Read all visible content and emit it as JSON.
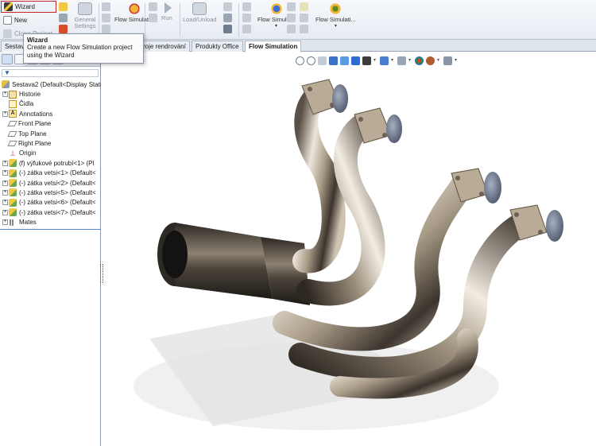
{
  "ribbon": {
    "wizard_label": "Wizard",
    "new_label": "New",
    "clone_label": "Clone Project",
    "general_settings_label": "General Settings",
    "flow_simulation_1_label": "Flow Simulati...",
    "run_label": "Run",
    "load_unload_label": "Load/Unload",
    "flow_simulation_2_label": "Flow Simula...",
    "flow_simulation_3_label": "Flow Simulati..."
  },
  "tooltip": {
    "title": "Wizard",
    "text": "Create a new Flow Simulation project using the Wizard"
  },
  "tabs": [
    {
      "label": "Sestav"
    },
    {
      "label": "roje rendrování"
    },
    {
      "label": "Produkty Office"
    },
    {
      "label": "Flow Simulation",
      "active": true
    }
  ],
  "tree": {
    "filter_label": "▼",
    "items": [
      {
        "label": "Sestava2  (Default<Display State",
        "icon": "assembly-icon"
      },
      {
        "label": "Historie",
        "icon": "history-folder-icon"
      },
      {
        "label": "Čidla",
        "icon": "sensors-icon"
      },
      {
        "label": "Annotations",
        "icon": "annotations-icon"
      },
      {
        "label": "Front Plane",
        "icon": "plane-icon"
      },
      {
        "label": "Top Plane",
        "icon": "plane-icon"
      },
      {
        "label": "Right Plane",
        "icon": "plane-icon"
      },
      {
        "label": "Origin",
        "icon": "origin-icon"
      },
      {
        "label": "(f) výfukové potrubí<1> (Pl",
        "icon": "part-icon"
      },
      {
        "label": "(-) zátka vetsi<1> (Default<",
        "icon": "part-icon"
      },
      {
        "label": "(-) zátka vetsi<2> (Default<",
        "icon": "part-icon"
      },
      {
        "label": "(-) zátka vetsi<5> (Default<",
        "icon": "part-icon"
      },
      {
        "label": "(-) zátka vetsi<6> (Default<",
        "icon": "part-icon"
      },
      {
        "label": "(-) zátka vetsi<7> (Default<",
        "icon": "part-icon"
      },
      {
        "label": "Mates",
        "icon": "mates-icon"
      }
    ]
  },
  "colors": {
    "wizard_highlight": "#c8242a",
    "tree_separator": "#5a86c4",
    "pipe_metal": "#b9ab95"
  }
}
